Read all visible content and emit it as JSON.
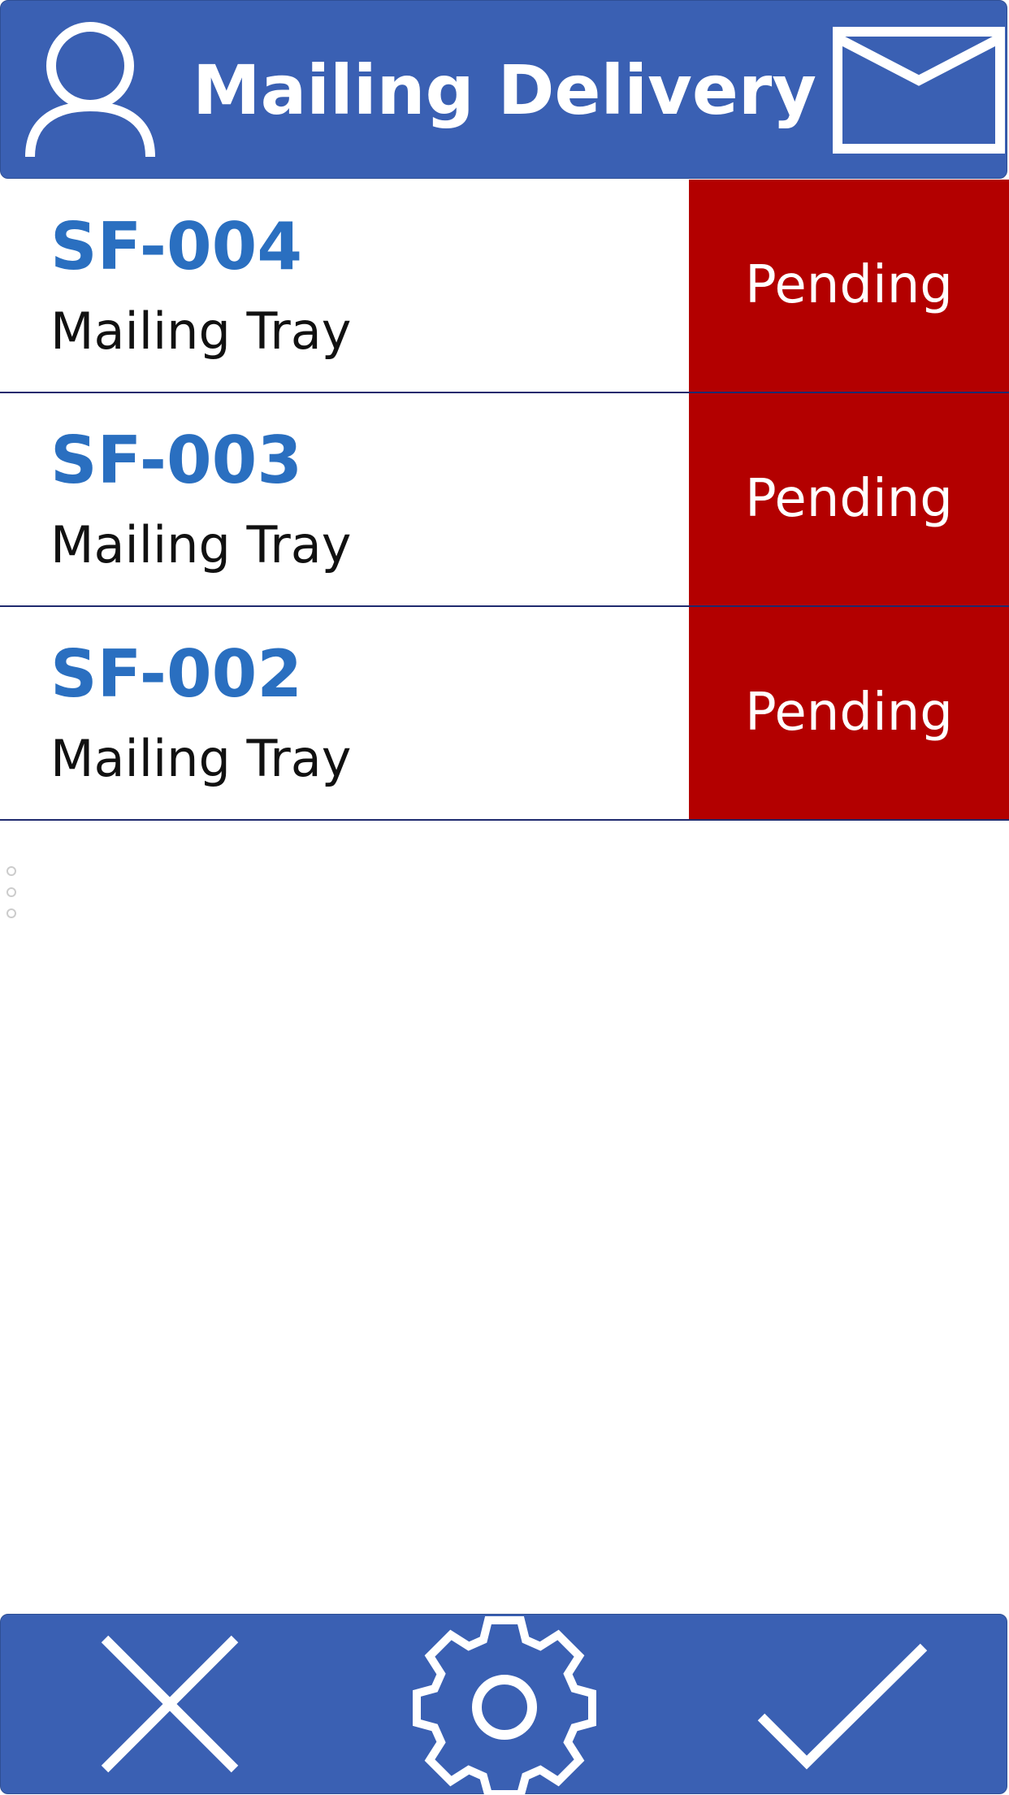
{
  "header": {
    "title": "Mailing Delivery",
    "user_icon": "user-icon",
    "mail_icon": "envelope-icon"
  },
  "items": [
    {
      "code": "SF-004",
      "subtitle": "Mailing Tray",
      "status": "Pending"
    },
    {
      "code": "SF-003",
      "subtitle": "Mailing Tray",
      "status": "Pending"
    },
    {
      "code": "SF-002",
      "subtitle": "Mailing Tray",
      "status": "Pending"
    }
  ],
  "footer": {
    "cancel_icon": "close-icon",
    "settings_icon": "gear-icon",
    "confirm_icon": "checkmark-icon"
  },
  "colors": {
    "brand": "#3a60b3",
    "code_text": "#2a6fc0",
    "status_pending": "#b30000"
  }
}
